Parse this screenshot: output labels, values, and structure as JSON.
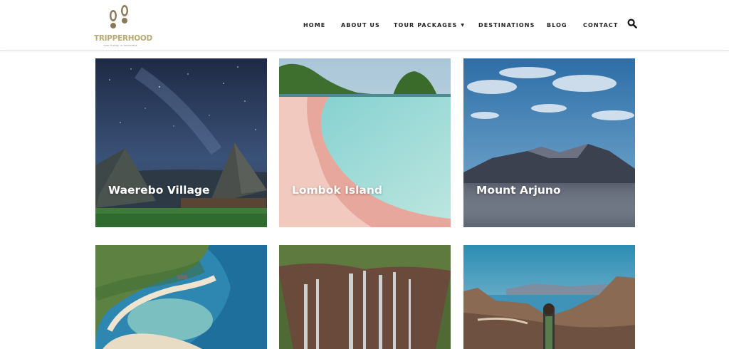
{
  "header": {
    "logo_text": "TRIPPERHOOD",
    "logo_tagline": "Your buddy in Indonesia",
    "nav": [
      {
        "label": "HOME"
      },
      {
        "label": "ABOUT US"
      },
      {
        "label": "TOUR PACKAGES",
        "has_dropdown": true
      },
      {
        "label": "DESTINATIONS"
      },
      {
        "label": "BLOG"
      },
      {
        "label": "CONTACT"
      }
    ],
    "search_icon": "search-icon"
  },
  "destinations": [
    {
      "title": "Waerebo Village"
    },
    {
      "title": "Lombok Island"
    },
    {
      "title": "Mount Arjuno"
    },
    {
      "title": ""
    },
    {
      "title": ""
    },
    {
      "title": ""
    }
  ],
  "colors": {
    "logo": "#b7ab71",
    "nav_text": "#222222",
    "card_title": "#ffffff"
  }
}
